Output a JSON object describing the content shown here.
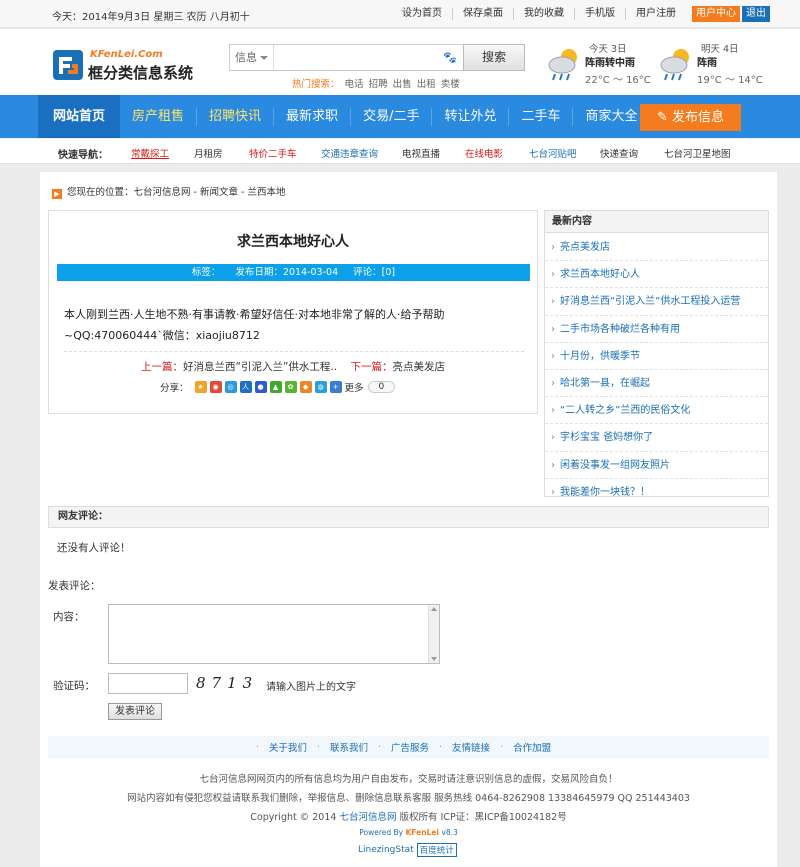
{
  "topbar": {
    "date": "今天：2014年9月3日 星期三    农历 八月初十",
    "links": [
      "设为首页",
      "保存桌面",
      "我的收藏",
      "手机版",
      "用户注册"
    ],
    "user_center": "用户中心",
    "logout": "退出"
  },
  "logo": {
    "site": "KFenLei.Com",
    "name": "框分类信息系统"
  },
  "search": {
    "category": "信息",
    "placeholder": "",
    "button": "搜索",
    "hot_label": "热门搜索：",
    "hot_keywords": [
      "电话",
      "招聘",
      "出售",
      "出租",
      "卖楼"
    ]
  },
  "weather": [
    {
      "day": "今天 3日",
      "condition": "阵雨转中雨",
      "temp": "22°C ～ 16°C"
    },
    {
      "day": "明天 4日",
      "condition": "阵雨",
      "temp": "19°C ～ 14°C"
    }
  ],
  "nav": {
    "items": [
      "网站首页",
      "房产租售",
      "招聘快讯",
      "最新求职",
      "交易/二手",
      "转让外兑",
      "二手车",
      "商家大全"
    ],
    "post_button": "发布信息"
  },
  "quicknav": {
    "title": "快速导航：",
    "items": [
      "常戴探工",
      "月租房",
      "特价二手车",
      "交通违章查询",
      "电视直播",
      "在线电影",
      "七台河贴吧",
      "快递查询",
      "七台河卫星地图"
    ],
    "colors": [
      "#d71c1c",
      "#333333",
      "#d71c1c",
      "#1a6fb7",
      "#333333",
      "#d71c1c",
      "#1a6fb7",
      "#333333",
      "#333333"
    ]
  },
  "breadcrumb": {
    "label": "您现在的位置：",
    "path": [
      "七台河信息网",
      "新闻文章",
      "兰西本地"
    ]
  },
  "article": {
    "title": "求兰西本地好心人",
    "tag_label": "标签：",
    "date": "发布日期：2014-03-04",
    "comments": "评论：[0]",
    "body": "本人刚到兰西·人生地不熟·有事请教·希望好信任·对本地非常了解的人·给予帮助~QQ:470060444`微信：xiaojiu8712",
    "prev_label": "上一篇：",
    "prev_title": "好消息兰西“引泥入兰”供水工程..",
    "next_label": "下一篇：",
    "next_title": "亮点美发店",
    "share_label": "分享：",
    "share_more": "更多",
    "share_count": "0"
  },
  "latest": {
    "title": "最新内容",
    "items": [
      "亮点美发店",
      "求兰西本地好心人",
      "好消息兰西“引泥入兰”供水工程投入运营",
      "二手市场各种破烂各种有用",
      "十月份，供暖季节",
      "哈北第一县，在崛起",
      "“二人转之乡”兰西的民俗文化",
      "宇杉宝宝 爸妈想你了",
      "闲着没事发一组网友照片",
      "我能差你一块钱？！"
    ]
  },
  "comments": {
    "title": "网友评论：",
    "empty": "还没有人评论！",
    "post_title": "发表评论：",
    "content_label": "内容：",
    "captcha_label": "验证码：",
    "captcha_code": "8713",
    "captcha_hint": "请输入图片上的文字",
    "submit": "发表评论"
  },
  "footer": {
    "links": [
      "关于我们",
      "联系我们",
      "广告服务",
      "友情链接",
      "合作加盟"
    ],
    "line1": "七台河信息网网页内的所有信息均为用户自由发布，交易时请注意识别信息的虚假，交易风险自负！",
    "line2": "网站内容如有侵犯您权益请联系我们删除，举报信息、删除信息联系客服   服务热线 0464-8262908 13384645979 QQ 251443403",
    "line3_pre": "Copyright © 2014 ",
    "line3_site": "七台河信息网",
    "line3_post": " 版权所有 ICP证：黑ICP备10024182号",
    "powered": "Powered By ",
    "powered_brand": "KFenLei",
    "powered_ver": " v8.3",
    "stat": "LinezingStat",
    "baidu": "百度统计"
  }
}
